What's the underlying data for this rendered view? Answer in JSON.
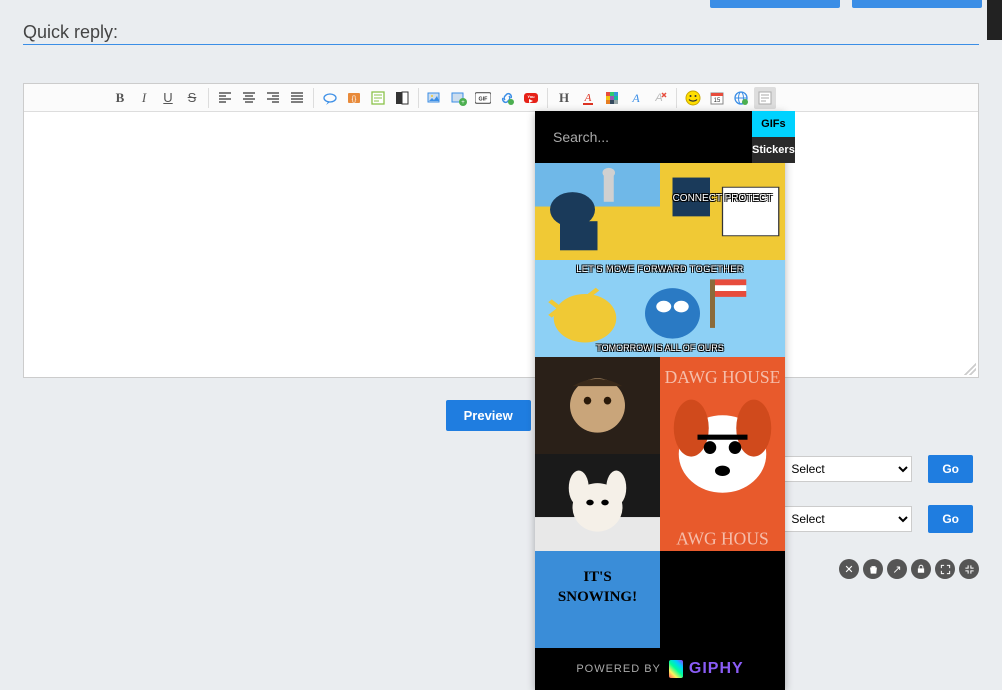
{
  "header": {
    "title": "Quick reply:"
  },
  "toolbar": {
    "bold": "B",
    "italic": "I",
    "underline": "U",
    "strike": "S",
    "align_left": "≡",
    "align_center": "≡",
    "align_right": "≡",
    "align_justify": "≡",
    "h": "H"
  },
  "buttons": {
    "preview": "Preview",
    "go": "Go"
  },
  "selects": {
    "placeholder": "Select"
  },
  "giphy": {
    "search_placeholder": "Search...",
    "tab_gifs": "GIFs",
    "tab_stickers": "Stickers",
    "powered": "POWERED BY",
    "brand": "GIPHY",
    "items": [
      {
        "caption_top": "",
        "caption_bottom": "",
        "theme": "a"
      },
      {
        "caption_top": "",
        "caption_bottom": "CONNECT\nPROTECT",
        "theme": "a2"
      },
      {
        "caption_top": "LET'S MOVE FORWARD TOGETHER",
        "caption_bottom": "TOMORROW IS ALL OF OURS",
        "theme": "b"
      },
      {
        "caption_top": "",
        "caption_bottom": "",
        "theme": "blank"
      },
      {
        "caption_top": "",
        "caption_bottom": "",
        "theme": "c"
      },
      {
        "caption_top": "DAWG HOUSE",
        "caption_bottom": "",
        "theme": "d"
      },
      {
        "caption_top": "",
        "caption_bottom": "",
        "theme": "e"
      },
      {
        "caption_top": "IT'S",
        "caption_bottom": "SNOWING!",
        "theme": "f"
      }
    ]
  }
}
